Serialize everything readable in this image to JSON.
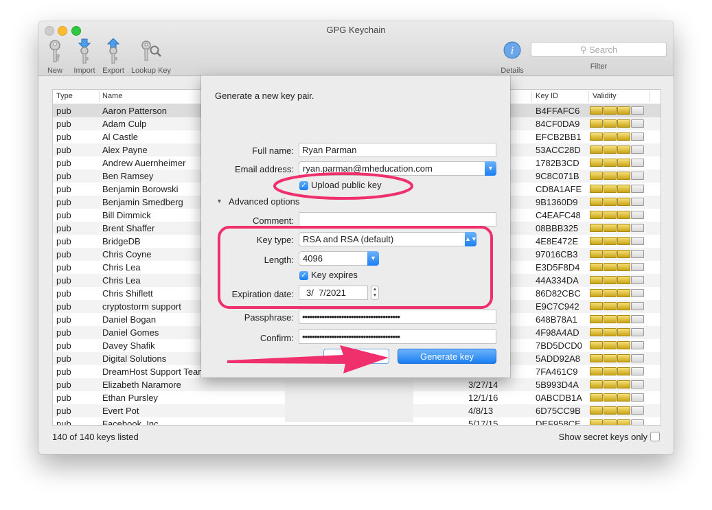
{
  "window": {
    "title": "GPG Keychain"
  },
  "toolbar": {
    "new_label": "New",
    "import_label": "Import",
    "export_label": "Export",
    "lookup_label": "Lookup Key",
    "details_label": "Details",
    "search_placeholder": "Search",
    "filter_label": "Filter"
  },
  "table": {
    "headers": {
      "type": "Type",
      "name": "Name",
      "key_id": "Key ID",
      "validity": "Validity"
    },
    "rows": [
      {
        "type": "pub",
        "name": "Aaron Patterson",
        "date": "",
        "key_id": "B4FFAFC6"
      },
      {
        "type": "pub",
        "name": "Adam Culp",
        "date": "",
        "key_id": "84CF0DA9"
      },
      {
        "type": "pub",
        "name": "Al Castle",
        "date": "",
        "key_id": "EFCB2BB1"
      },
      {
        "type": "pub",
        "name": "Alex Payne",
        "date": "",
        "key_id": "53ACC28D"
      },
      {
        "type": "pub",
        "name": "Andrew Auernheimer",
        "date": "",
        "key_id": "1782B3CD"
      },
      {
        "type": "pub",
        "name": "Ben Ramsey",
        "date": "",
        "key_id": "9C8C071B"
      },
      {
        "type": "pub",
        "name": "Benjamin Borowski",
        "date": "",
        "key_id": "CD8A1AFE"
      },
      {
        "type": "pub",
        "name": "Benjamin Smedberg",
        "date": "",
        "key_id": "9B1360D9"
      },
      {
        "type": "pub",
        "name": "Bill Dimmick",
        "date": "",
        "key_id": "C4EAFC48"
      },
      {
        "type": "pub",
        "name": "Brent Shaffer",
        "date": "",
        "key_id": "08BBB325"
      },
      {
        "type": "pub",
        "name": "BridgeDB",
        "date": "",
        "key_id": "4E8E472E"
      },
      {
        "type": "pub",
        "name": "Chris Coyne",
        "date": "",
        "key_id": "97016CB3"
      },
      {
        "type": "pub",
        "name": "Chris Lea",
        "date": "",
        "key_id": "E3D5F8D4"
      },
      {
        "type": "pub",
        "name": "Chris Lea",
        "date": "",
        "key_id": "44A334DA"
      },
      {
        "type": "pub",
        "name": "Chris Shiflett",
        "date": "",
        "key_id": "86D82CBC"
      },
      {
        "type": "pub",
        "name": "cryptostorm support",
        "date": "",
        "key_id": "E9C7C942"
      },
      {
        "type": "pub",
        "name": "Daniel Bogan",
        "date": "",
        "key_id": "648B78A1"
      },
      {
        "type": "pub",
        "name": "Daniel Gomes",
        "date": "",
        "key_id": "4F98A4AD"
      },
      {
        "type": "pub",
        "name": "Davey Shafik",
        "date": "",
        "key_id": "7BD5DCD0"
      },
      {
        "type": "pub",
        "name": "Digital Solutions",
        "date": "",
        "key_id": "5ADD92A8"
      },
      {
        "type": "pub",
        "name": "DreamHost Support Team",
        "date": "",
        "key_id": "7FA461C9"
      },
      {
        "type": "pub",
        "name": "Elizabeth Naramore",
        "date": "3/27/14",
        "key_id": "5B993D4A"
      },
      {
        "type": "pub",
        "name": "Ethan Pursley",
        "date": "12/1/16",
        "key_id": "0ABCDB1A"
      },
      {
        "type": "pub",
        "name": "Evert Pot",
        "date": "4/8/13",
        "key_id": "6D75CC9B"
      },
      {
        "type": "pub",
        "name": "Facebook, Inc.",
        "date": "5/17/15",
        "key_id": "DEF958CE"
      }
    ]
  },
  "footer": {
    "count": "140 of 140 keys listed",
    "secret": "Show secret keys only"
  },
  "sheet": {
    "title": "Generate a new key pair.",
    "full_name_label": "Full name:",
    "full_name_value": "Ryan Parman",
    "email_label": "Email address:",
    "email_value": "ryan.parman@mheducation.com",
    "upload_label": "Upload public key",
    "advanced_label": "Advanced options",
    "comment_label": "Comment:",
    "comment_value": "",
    "key_type_label": "Key type:",
    "key_type_value": "RSA and RSA (default)",
    "length_label": "Length:",
    "length_value": "4096",
    "key_expires_label": "Key expires",
    "expiration_label": "Expiration date:",
    "expiration_value": "3/  7/2021",
    "passphrase_label": "Passphrase:",
    "passphrase_value": "••••••••••••••••••••••••••••••••••••••••",
    "confirm_label": "Confirm:",
    "confirm_value": "••••••••••••••••••••••••••••••••••••••••",
    "generate_label": "Generate key"
  },
  "colors": {
    "annotation": "#f0306d",
    "accent": "#1a7ef2",
    "gold": "#d9b92a"
  }
}
